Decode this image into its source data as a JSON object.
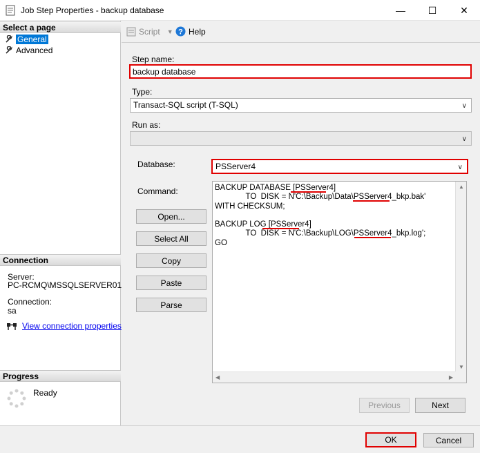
{
  "window": {
    "title": "Job Step Properties - backup database",
    "minimize_icon": "—",
    "maximize_icon": "☐",
    "close_icon": "✕"
  },
  "left": {
    "select_page_header": "Select a page",
    "pages": [
      {
        "label": "General",
        "selected": true
      },
      {
        "label": "Advanced",
        "selected": false
      }
    ],
    "connection_header": "Connection",
    "server_label": "Server:",
    "server_value": "PC-RCMQ\\MSSQLSERVER01",
    "connection_label": "Connection:",
    "connection_value": "sa",
    "view_connection_link": "View connection properties",
    "progress_header": "Progress",
    "progress_status": "Ready"
  },
  "toolbar": {
    "script_label": "Script",
    "help_label": "Help"
  },
  "form": {
    "step_name_label": "Step name:",
    "step_name_value": "backup database",
    "type_label": "Type:",
    "type_value": "Transact-SQL script (T-SQL)",
    "run_as_label": "Run as:",
    "run_as_value": "",
    "database_label": "Database:",
    "database_value": "PSServer4",
    "command_label": "Command:",
    "command_text": "BACKUP DATABASE [PSServer4]\n              TO  DISK = N'C:\\Backup\\Data\\PSServer4_bkp.bak'\nWITH CHECKSUM;\n\nBACKUP LOG [PSServer4]\n              TO  DISK = N'C:\\Backup\\LOG\\PSServer4_bkp.log';\nGO"
  },
  "command_buttons": {
    "open": "Open...",
    "select_all": "Select All",
    "copy": "Copy",
    "paste": "Paste",
    "parse": "Parse"
  },
  "nav": {
    "previous": "Previous",
    "next": "Next"
  },
  "dialog_buttons": {
    "ok": "OK",
    "cancel": "Cancel"
  },
  "colors": {
    "highlight": "#e00000",
    "selection": "#0078d7",
    "link": "#0000ee"
  }
}
